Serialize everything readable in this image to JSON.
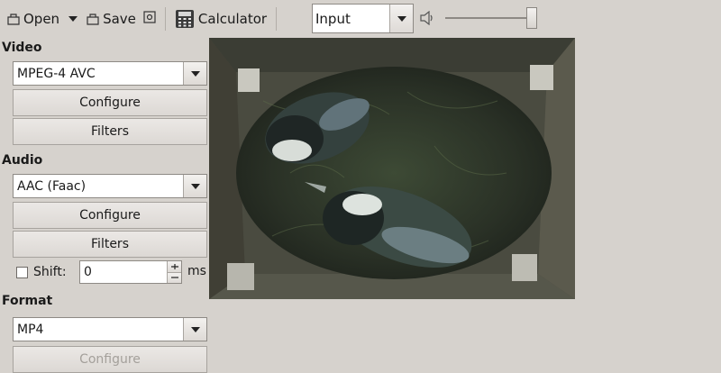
{
  "toolbar": {
    "open_label": "Open",
    "save_label": "Save",
    "calculator_label": "Calculator",
    "input_combo": {
      "selected": "Input"
    },
    "volume_level": 0.92
  },
  "video": {
    "section_label": "Video",
    "codec": "MPEG-4 AVC",
    "configure_label": "Configure",
    "filters_label": "Filters"
  },
  "audio": {
    "section_label": "Audio",
    "codec": "AAC (Faac)",
    "configure_label": "Configure",
    "filters_label": "Filters",
    "shift": {
      "label": "Shift:",
      "checked": false,
      "value": "0",
      "unit": "ms"
    }
  },
  "format": {
    "section_label": "Format",
    "container": "MP4",
    "configure_label": "Configure"
  }
}
